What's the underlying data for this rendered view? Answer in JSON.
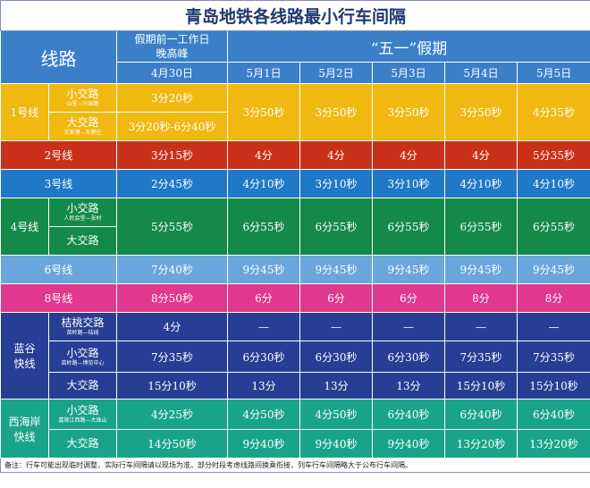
{
  "title": "青岛地铁各线路最小行车间隔",
  "header": {
    "route_label": "线路",
    "workday_label_line1": "假期前一工作日",
    "workday_label_line2": "晚高峰",
    "holiday_label": "“五一”假期",
    "dates": [
      "4月30日",
      "5月1日",
      "5月2日",
      "5月3日",
      "5月4日",
      "5月5日"
    ]
  },
  "rows": {
    "line1": {
      "name": "1号线",
      "small": {
        "label": "小交路",
        "detail": "山里—兴国路",
        "values": [
          "3分20秒"
        ]
      },
      "big": {
        "label": "大交路",
        "detail": "王家港—东郭庄",
        "values": [
          "3分20秒-6分40秒"
        ]
      },
      "holiday": [
        "3分50秒",
        "3分50秒",
        "3分50秒",
        "3分50秒",
        "4分35秒"
      ]
    },
    "line2": {
      "name": "2号线",
      "values": [
        "3分15秒",
        "4分",
        "4分",
        "4分",
        "4分",
        "5分35秒"
      ]
    },
    "line3": {
      "name": "3号线",
      "values": [
        "2分45秒",
        "4分10秒",
        "3分10秒",
        "3分10秒",
        "4分10秒",
        "4分10秒"
      ]
    },
    "line4": {
      "name": "4号线",
      "small": {
        "label": "小交路",
        "detail": "人民会堂—张村"
      },
      "big": {
        "label": "大交路"
      },
      "values": [
        "5分55秒",
        "6分55秒",
        "6分55秒",
        "6分55秒",
        "6分55秒",
        "6分55秒"
      ]
    },
    "line6": {
      "name": "6号线",
      "values": [
        "7分40秒",
        "9分45秒",
        "9分45秒",
        "9分45秒",
        "9分45秒",
        "9分45秒"
      ]
    },
    "line8": {
      "name": "8号线",
      "values": [
        "8分50秒",
        "6分",
        "6分",
        "6分",
        "8分",
        "8分"
      ]
    },
    "langu": {
      "name_line1": "蓝谷",
      "name_line2": "快线",
      "peach": {
        "label": "桔桃交路",
        "detail": "苗岭路—桔线",
        "values": [
          "4分",
          "—",
          "—",
          "—",
          "—",
          "—"
        ]
      },
      "small": {
        "label": "小交路",
        "detail": "苗岭路—博览中心",
        "values": [
          "7分35秒",
          "6分30秒",
          "6分30秒",
          "6分30秒",
          "7分35秒",
          "7分35秒"
        ]
      },
      "big": {
        "label": "大交路",
        "values": [
          "15分10秒",
          "13分",
          "13分",
          "13分",
          "15分10秒",
          "15分10秒"
        ]
      }
    },
    "xihaian": {
      "name_line1": "西海岸",
      "name_line2": "快线",
      "small": {
        "label": "小交路",
        "detail": "嘉陵江西路—大珠山",
        "values": [
          "4分25秒",
          "4分50秒",
          "4分50秒",
          "6分40秒",
          "6分40秒",
          "6分40秒"
        ]
      },
      "big": {
        "label": "大交路",
        "values": [
          "14分50秒",
          "9分40秒",
          "9分40秒",
          "9分40秒",
          "13分20秒",
          "13分20秒"
        ]
      }
    }
  },
  "note": "备注：行车可能出现临时调整，实际行车间隔请以现场为准。部分时段考虑线路间换乘衔接，列车行车间隔略大于公布行车间隔。",
  "colors": {
    "header": "#3a7fc8",
    "line1": "#f0b810",
    "line2": "#c9301a",
    "line3": "#1f78c8",
    "line4": "#138a48",
    "line6": "#6aa6dc",
    "line8": "#e0378f",
    "langu": "#283e95",
    "xihaian": "#1aa487"
  }
}
